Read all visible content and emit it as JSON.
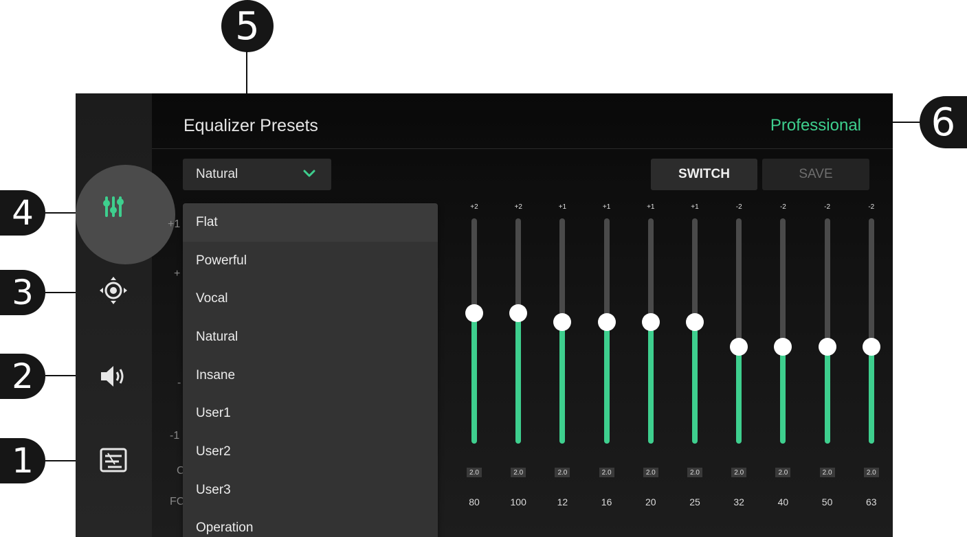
{
  "callouts": [
    "5",
    "6",
    "4",
    "3",
    "2",
    "1"
  ],
  "header": {
    "title": "Equalizer Presets",
    "mode": "Professional"
  },
  "preset_select": {
    "value": "Natural",
    "chevron_color": "#3ecf8e"
  },
  "buttons": {
    "switch": "SWITCH",
    "save": "SAVE"
  },
  "preset_options": [
    "Flat",
    "Powerful",
    "Vocal",
    "Natural",
    "Insane",
    "User1",
    "User2",
    "User3",
    "Operation"
  ],
  "sidebar": {
    "items": [
      "equalizer-sliders-icon",
      "surround-position-icon",
      "speaker-volume-icon",
      "crossover-filter-icon"
    ],
    "active": "equalizer-sliders-icon"
  },
  "background_labels": [
    "+1",
    "+",
    "-",
    "-1",
    "C",
    "FC"
  ],
  "bands": [
    {
      "gain": "+2",
      "q": "2.0",
      "freq": "80",
      "level": 0.58
    },
    {
      "gain": "+2",
      "q": "2.0",
      "freq": "100",
      "level": 0.58
    },
    {
      "gain": "+1",
      "q": "2.0",
      "freq": "12",
      "level": 0.54
    },
    {
      "gain": "+1",
      "q": "2.0",
      "freq": "16",
      "level": 0.54
    },
    {
      "gain": "+1",
      "q": "2.0",
      "freq": "20",
      "level": 0.54
    },
    {
      "gain": "+1",
      "q": "2.0",
      "freq": "25",
      "level": 0.54
    },
    {
      "gain": "-2",
      "q": "2.0",
      "freq": "32",
      "level": 0.43
    },
    {
      "gain": "-2",
      "q": "2.0",
      "freq": "40",
      "level": 0.43
    },
    {
      "gain": "-2",
      "q": "2.0",
      "freq": "50",
      "level": 0.43
    },
    {
      "gain": "-2",
      "q": "2.0",
      "freq": "63",
      "level": 0.43
    }
  ],
  "colors": {
    "accent": "#3ecf8e",
    "track": "#4a4a4a",
    "knob": "#ffffff"
  }
}
